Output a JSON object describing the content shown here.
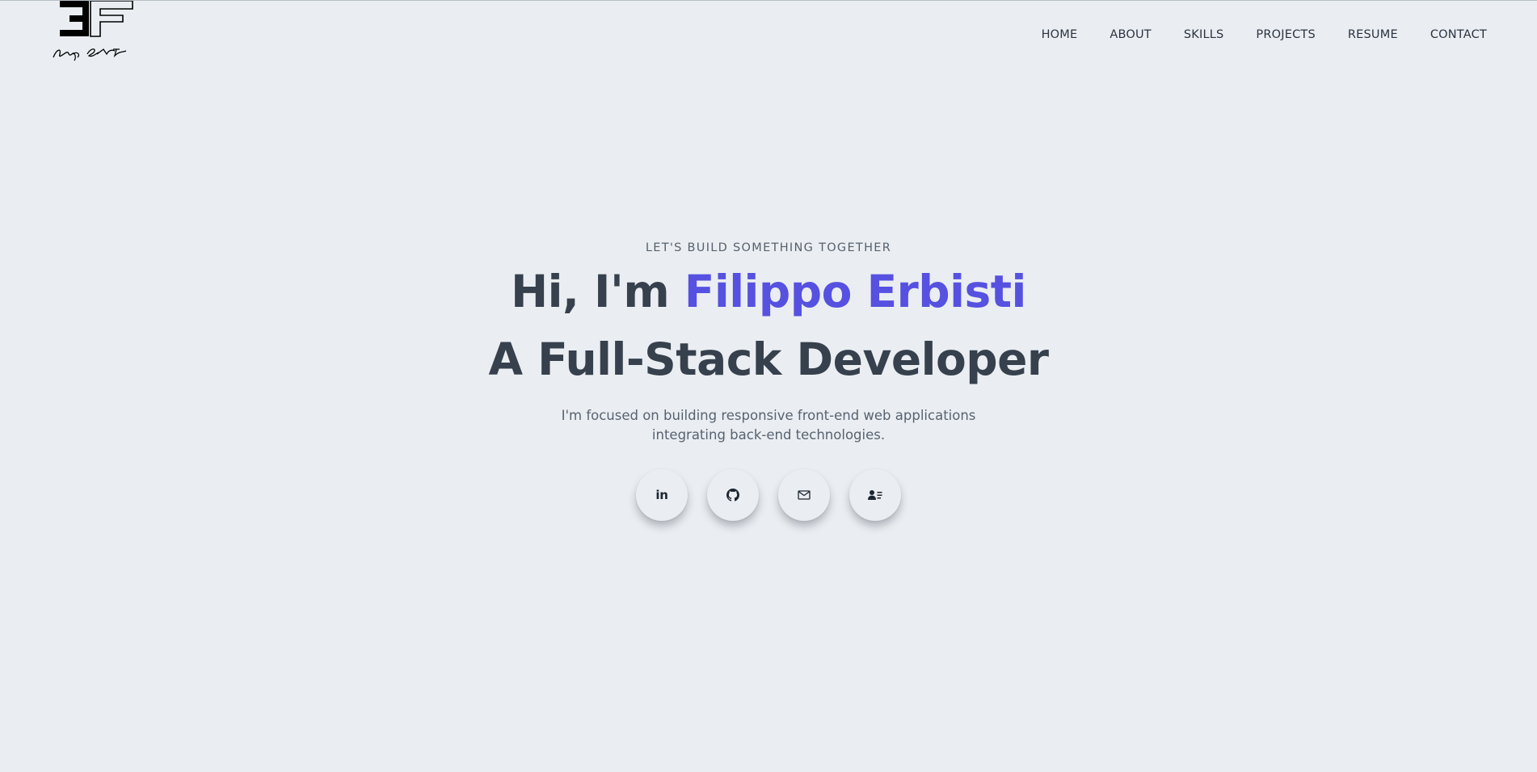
{
  "header": {
    "logo_icon": "ef-signature-logo",
    "nav": [
      {
        "label": "HOME"
      },
      {
        "label": "ABOUT"
      },
      {
        "label": "SKILLS"
      },
      {
        "label": "PROJECTS"
      },
      {
        "label": "RESUME"
      },
      {
        "label": "CONTACT"
      }
    ]
  },
  "hero": {
    "eyebrow": "LET'S BUILD SOMETHING TOGETHER",
    "greeting": "Hi, I'm ",
    "name": "Filippo Erbisti",
    "role": "A Full-Stack Developer",
    "description": "I'm focused on building responsive front-end web applications integrating back-end technologies.",
    "socials": [
      {
        "icon": "linkedin-icon",
        "text": "in"
      },
      {
        "icon": "github-icon"
      },
      {
        "icon": "mail-icon"
      },
      {
        "icon": "contact-card-icon"
      }
    ]
  },
  "colors": {
    "background": "#eaeef2",
    "accent": "#5651e0",
    "heading": "#37404d",
    "text": "#586270"
  }
}
